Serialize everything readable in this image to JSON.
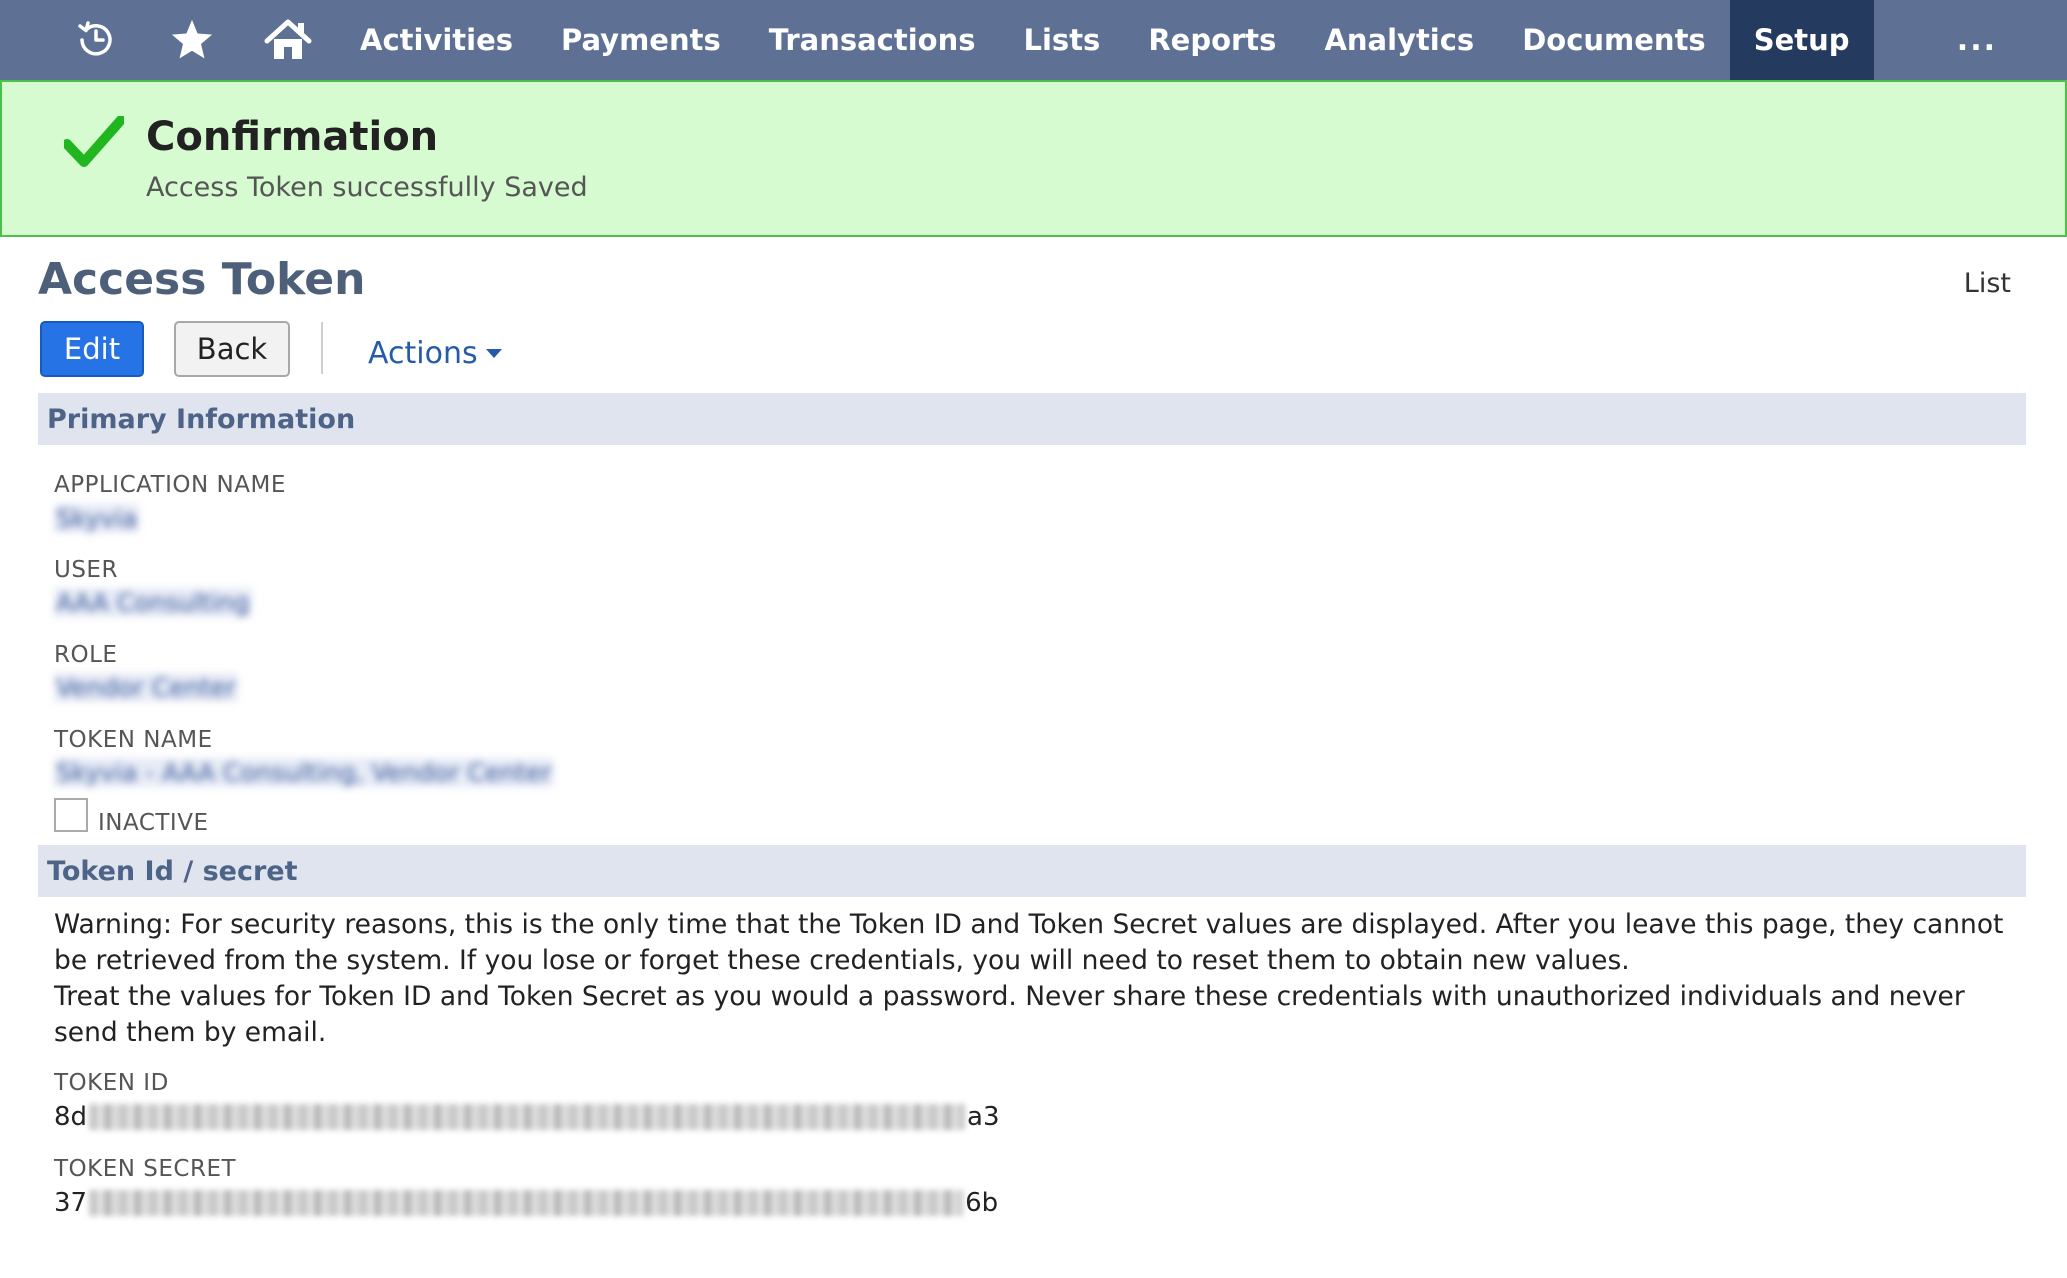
{
  "nav": {
    "items": [
      {
        "label": "Activities"
      },
      {
        "label": "Payments"
      },
      {
        "label": "Transactions"
      },
      {
        "label": "Lists"
      },
      {
        "label": "Reports"
      },
      {
        "label": "Analytics"
      },
      {
        "label": "Documents"
      },
      {
        "label": "Setup",
        "active": true
      }
    ],
    "more": "...",
    "icons": [
      "recent-history-icon",
      "star-icon",
      "home-icon"
    ]
  },
  "confirmation": {
    "title": "Confirmation",
    "message": "Access Token successfully Saved",
    "icon": "checkmark-icon"
  },
  "page": {
    "title": "Access Token",
    "list_link": "List"
  },
  "toolbar": {
    "edit_label": "Edit",
    "back_label": "Back",
    "actions_label": "Actions"
  },
  "primary": {
    "header": "Primary Information",
    "application_name_label": "APPLICATION NAME",
    "application_name_value": "Skyvia",
    "user_label": "USER",
    "user_value": "AAA Consulting",
    "role_label": "ROLE",
    "role_value": "Vendor Center",
    "token_name_label": "TOKEN NAME",
    "token_name_value": "Skyvia - AAA Consulting, Vendor Center",
    "inactive_label": "INACTIVE",
    "inactive_checked": false
  },
  "token": {
    "header": "Token Id / secret",
    "warning_line1": "Warning: For security reasons, this is the only time that the Token ID and Token Secret values are displayed. After you leave this page, they cannot be retrieved from the system. If you lose or forget these credentials, you will need to reset them to obtain new values.",
    "warning_line2": "Treat the values for Token ID and Token Secret as you would a password. Never share these credentials with unauthorized individuals and never send them by email.",
    "id_label": "TOKEN ID",
    "id_prefix": "8d",
    "id_suffix": "a3",
    "secret_label": "TOKEN SECRET",
    "secret_prefix": "37",
    "secret_suffix": "6b"
  },
  "colors": {
    "nav_bg": "#5e7195",
    "nav_active": "#243a5e",
    "confirm_bg": "#d6fbd0",
    "confirm_border": "#4cc14a",
    "primary_button": "#2673e5",
    "section_bg": "#dfe4ee",
    "section_text": "#4d6387"
  }
}
